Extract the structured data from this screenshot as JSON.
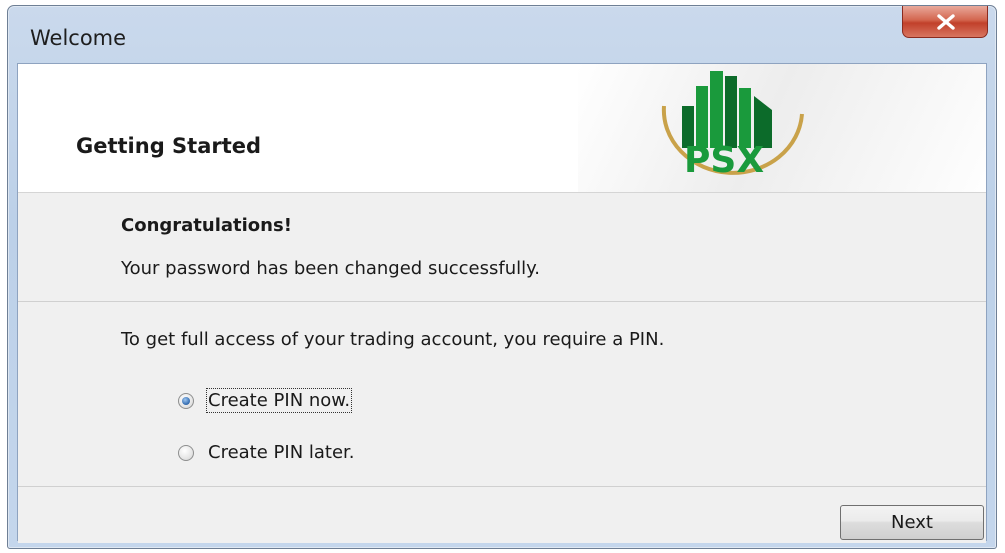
{
  "window": {
    "title": "Welcome",
    "close_icon": "close-icon"
  },
  "header": {
    "title": "Getting Started",
    "logo_text": "PSX"
  },
  "message": {
    "heading": "Congratulations!",
    "body": "Your password has been changed successfully."
  },
  "instruction": "To get full access of your trading account, you require a PIN.",
  "options": [
    {
      "label": "Create PIN now.",
      "selected": true
    },
    {
      "label": "Create PIN later.",
      "selected": false
    }
  ],
  "footer": {
    "next_label": "Next"
  },
  "colors": {
    "logo_green": "#1a9a3c",
    "logo_dark_green": "#0c6b2a",
    "logo_gold": "#c9a24a",
    "close_red": "#c1402a"
  }
}
